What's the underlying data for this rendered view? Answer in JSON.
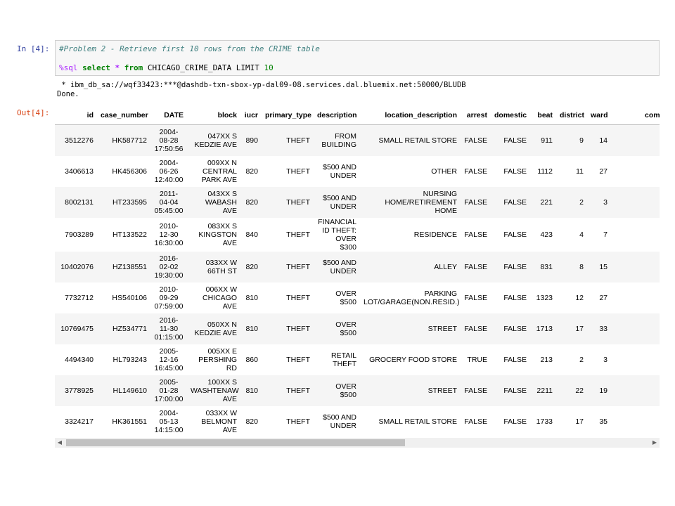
{
  "input": {
    "prompt": "In [4]:",
    "comment": "#Problem 2 - Retrieve first 10 rows from the CRIME table",
    "magic": "%sql",
    "kw_select": "select",
    "star": "*",
    "kw_from": "from",
    "table": "CHICAGO_CRIME_DATA",
    "limit_kw": "LIMIT",
    "limit_val": "10"
  },
  "stdout": {
    "connection": " * ibm_db_sa://wqf33423:***@dashdb-txn-sbox-yp-dal09-08.services.dal.bluemix.net:50000/BLUDB",
    "done": "Done."
  },
  "output": {
    "prompt": "Out[4]:",
    "columns": [
      "id",
      "case_number",
      "DATE",
      "block",
      "iucr",
      "primary_type",
      "description",
      "location_description",
      "arrest",
      "domestic",
      "beat",
      "district",
      "ward",
      "community"
    ],
    "rows": [
      [
        "3512276",
        "HK587712",
        "2004-\n08-28\n17:50:56",
        "047XX S\nKEDZIE AVE",
        "890",
        "THEFT",
        "FROM\nBUILDING",
        "SMALL RETAIL STORE",
        "FALSE",
        "FALSE",
        "911",
        "9",
        "14",
        ""
      ],
      [
        "3406613",
        "HK456306",
        "2004-\n06-26\n12:40:00",
        "009XX N\nCENTRAL\nPARK AVE",
        "820",
        "THEFT",
        "$500 AND\nUNDER",
        "OTHER",
        "FALSE",
        "FALSE",
        "1112",
        "11",
        "27",
        ""
      ],
      [
        "8002131",
        "HT233595",
        "2011-\n04-04\n05:45:00",
        "043XX S\nWABASH AVE",
        "820",
        "THEFT",
        "$500 AND\nUNDER",
        "NURSING\nHOME/RETIREMENT HOME",
        "FALSE",
        "FALSE",
        "221",
        "2",
        "3",
        ""
      ],
      [
        "7903289",
        "HT133522",
        "2010-\n12-30\n16:30:00",
        "083XX S\nKINGSTON\nAVE",
        "840",
        "THEFT",
        "FINANCIAL\nID THEFT:\nOVER $300",
        "RESIDENCE",
        "FALSE",
        "FALSE",
        "423",
        "4",
        "7",
        ""
      ],
      [
        "10402076",
        "HZ138551",
        "2016-\n02-02\n19:30:00",
        "033XX W\n66TH ST",
        "820",
        "THEFT",
        "$500 AND\nUNDER",
        "ALLEY",
        "FALSE",
        "FALSE",
        "831",
        "8",
        "15",
        ""
      ],
      [
        "7732712",
        "HS540106",
        "2010-\n09-29\n07:59:00",
        "006XX W\nCHICAGO\nAVE",
        "810",
        "THEFT",
        "OVER $500",
        "PARKING\nLOT/GARAGE(NON.RESID.)",
        "FALSE",
        "FALSE",
        "1323",
        "12",
        "27",
        ""
      ],
      [
        "10769475",
        "HZ534771",
        "2016-\n11-30\n01:15:00",
        "050XX N\nKEDZIE AVE",
        "810",
        "THEFT",
        "OVER $500",
        "STREET",
        "FALSE",
        "FALSE",
        "1713",
        "17",
        "33",
        ""
      ],
      [
        "4494340",
        "HL793243",
        "2005-\n12-16\n16:45:00",
        "005XX E\nPERSHING\nRD",
        "860",
        "THEFT",
        "RETAIL\nTHEFT",
        "GROCERY FOOD STORE",
        "TRUE",
        "FALSE",
        "213",
        "2",
        "3",
        ""
      ],
      [
        "3778925",
        "HL149610",
        "2005-\n01-28\n17:00:00",
        "100XX S\nWASHTENAW\nAVE",
        "810",
        "THEFT",
        "OVER $500",
        "STREET",
        "FALSE",
        "FALSE",
        "2211",
        "22",
        "19",
        ""
      ],
      [
        "3324217",
        "HK361551",
        "2004-\n05-13\n14:15:00",
        "033XX W\nBELMONT\nAVE",
        "820",
        "THEFT",
        "$500 AND\nUNDER",
        "SMALL RETAIL STORE",
        "FALSE",
        "FALSE",
        "1733",
        "17",
        "35",
        ""
      ]
    ]
  },
  "scrollbar": {
    "left_icon": "triangle-left-icon",
    "right_icon": "triangle-right-icon",
    "left_glyph": "◀",
    "right_glyph": "▶"
  }
}
